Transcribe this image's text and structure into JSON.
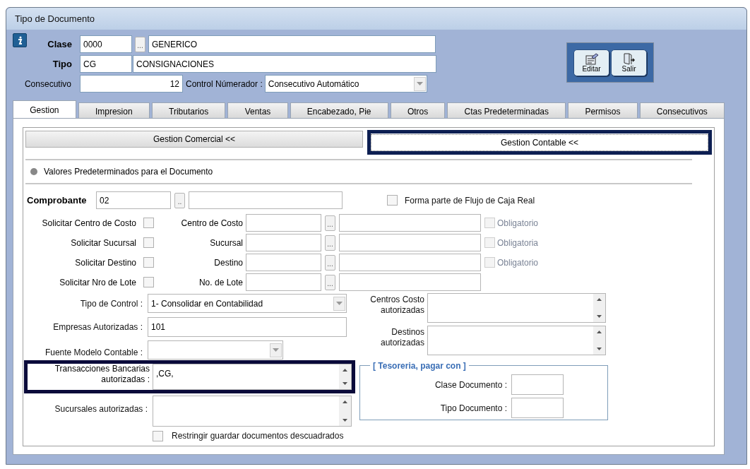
{
  "window": {
    "title": "Tipo de Documento"
  },
  "header": {
    "clase": {
      "label": "Clase",
      "code": "0000",
      "lookup": "...",
      "name": "GENERICO"
    },
    "tipo": {
      "label": "Tipo",
      "code": "CG",
      "name": "CONSIGNACIONES"
    },
    "consecutivo": {
      "label": "Consecutivo",
      "value": "12"
    },
    "control_numerador": {
      "label": "Control Númerador :",
      "value": "Consecutivo Automático"
    }
  },
  "toolbar": [
    {
      "label": "Editar",
      "kind": "edit"
    },
    {
      "label": "Salir",
      "kind": "exit"
    }
  ],
  "tabs": [
    {
      "label": "Gestion",
      "selected": true
    },
    {
      "label": "Impresion",
      "selected": false
    },
    {
      "label": "Tributarios",
      "selected": false
    },
    {
      "label": "Ventas",
      "selected": false
    },
    {
      "label": "Encabezado, Pie",
      "selected": false
    },
    {
      "label": "Otros",
      "selected": false
    },
    {
      "label": "Ctas Predeterminadas",
      "selected": false
    },
    {
      "label": "Permisos",
      "selected": false
    },
    {
      "label": "Consecutivos",
      "selected": false
    }
  ],
  "sections": [
    {
      "label": "Gestion Comercial <<",
      "highlighted": false
    },
    {
      "label": "Gestion Contable <<",
      "highlighted": true
    }
  ],
  "group_title": "Valores Predeterminados para el Documento",
  "comprobante": {
    "label": "Comprobante",
    "value": "02",
    "lookup": ".."
  },
  "flujo_caja": {
    "label": "Forma parte de Flujo de Caja  Real",
    "checked": false
  },
  "request_rows": [
    {
      "label": "Solicitar Centro de Costo",
      "checked": false,
      "field_label": "Centro de Costo",
      "lookup": "...",
      "required": {
        "label": "Obligatorio",
        "checked": false,
        "disabled": true
      }
    },
    {
      "label": "Solicitar Sucursal",
      "checked": false,
      "field_label": "Sucursal",
      "lookup": "...",
      "required": {
        "label": "Obligatoria",
        "checked": false,
        "disabled": true
      }
    },
    {
      "label": "Solicitar Destino",
      "checked": false,
      "field_label": "Destino",
      "lookup": "...",
      "required": {
        "label": "Obligatorio",
        "checked": false,
        "disabled": true
      }
    },
    {
      "label": "Solicitar Nro de  Lote",
      "checked": false,
      "field_label": "No. de Lote",
      "lookup": "..."
    }
  ],
  "tipo_control": {
    "label": "Tipo de Control :",
    "value": "1- Consolidar en Contabilidad"
  },
  "empresas": {
    "label": "Empresas Autorizadas :",
    "value": "101"
  },
  "fuente": {
    "label": "Fuente Modelo Contable :"
  },
  "transacciones": {
    "label": "Transacciones Bancarias autorizadas :",
    "value": ",CG,",
    "highlighted": true
  },
  "sucursales": {
    "label": "Sucursales autorizadas :"
  },
  "restringir": {
    "label": "Restringir guardar documentos descuadrados",
    "checked": false
  },
  "centros_costo": {
    "label": "Centros Costo autorizadas"
  },
  "destinos": {
    "label": "Destinos autorizadas"
  },
  "tesoreria": {
    "title": "[ Tesoreria, pagar con ]",
    "clase_label": "Clase Documento :",
    "tipo_label": "Tipo Documento :"
  }
}
